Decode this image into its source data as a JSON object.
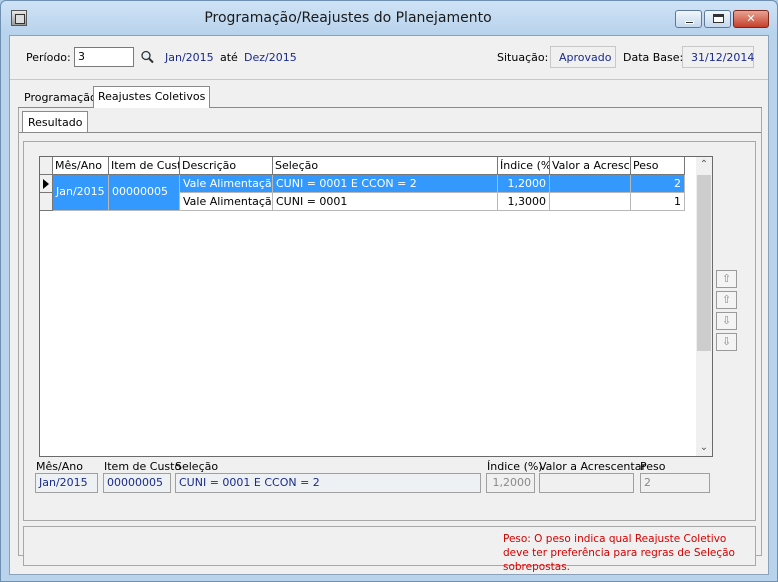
{
  "window": {
    "title": "Programação/Reajustes do Planejamento",
    "controls": {
      "minimize": "minimize",
      "maximize": "maximize",
      "close": "✕"
    }
  },
  "header": {
    "periodo_label": "Período:",
    "periodo_value": "3",
    "start": "Jan/2015",
    "ate": "até",
    "end": "Dez/2015",
    "situacao_label": "Situação:",
    "situacao_value": "Aprovado",
    "database_label": "Data Base:",
    "database_value": "31/12/2014"
  },
  "tabs": [
    {
      "label": "Programação",
      "active": false
    },
    {
      "label": "Reajustes Coletivos",
      "active": true
    }
  ],
  "subtab": "Resultado",
  "grid": {
    "columns": [
      "Mês/Ano",
      "Item de Custo",
      "Descrição",
      "Seleção",
      "Índice (%)",
      "Valor a Acrescentar",
      "Peso"
    ],
    "group": {
      "mes_ano": "Jan/2015",
      "item_custo": "00000005"
    },
    "rows": [
      {
        "descricao": "Vale Alimentação",
        "selecao": "CUNI = 0001 E CCON = 2",
        "indice": "1,2000",
        "valor": "",
        "peso": "2",
        "selected": true
      },
      {
        "descricao": "Vale Alimentação",
        "selecao": "CUNI = 0001",
        "indice": "1,3000",
        "valor": "",
        "peso": "1",
        "selected": false
      }
    ]
  },
  "side_buttons": {
    "top": "⇧",
    "up": "⇧",
    "down": "⇩",
    "bottom": "⇩"
  },
  "detail": {
    "labels": {
      "mes_ano": "Mês/Ano",
      "item_custo": "Item de Custo",
      "selecao": "Seleção",
      "indice": "Índice (%)",
      "valor": "Valor a Acrescentar",
      "peso": "Peso"
    },
    "values": {
      "mes_ano": "Jan/2015",
      "item_custo": "00000005",
      "selecao": "CUNI = 0001 E CCON = 2",
      "indice": "1,2000",
      "valor": "",
      "peso": "2"
    }
  },
  "note": "Peso: O peso indica qual Reajuste Coletivo deve ter preferência para regras de Seleção sobrepostas.",
  "colors": {
    "selection": "#3399ff",
    "value_text": "#1a2a8a",
    "note_text": "#d40000"
  }
}
